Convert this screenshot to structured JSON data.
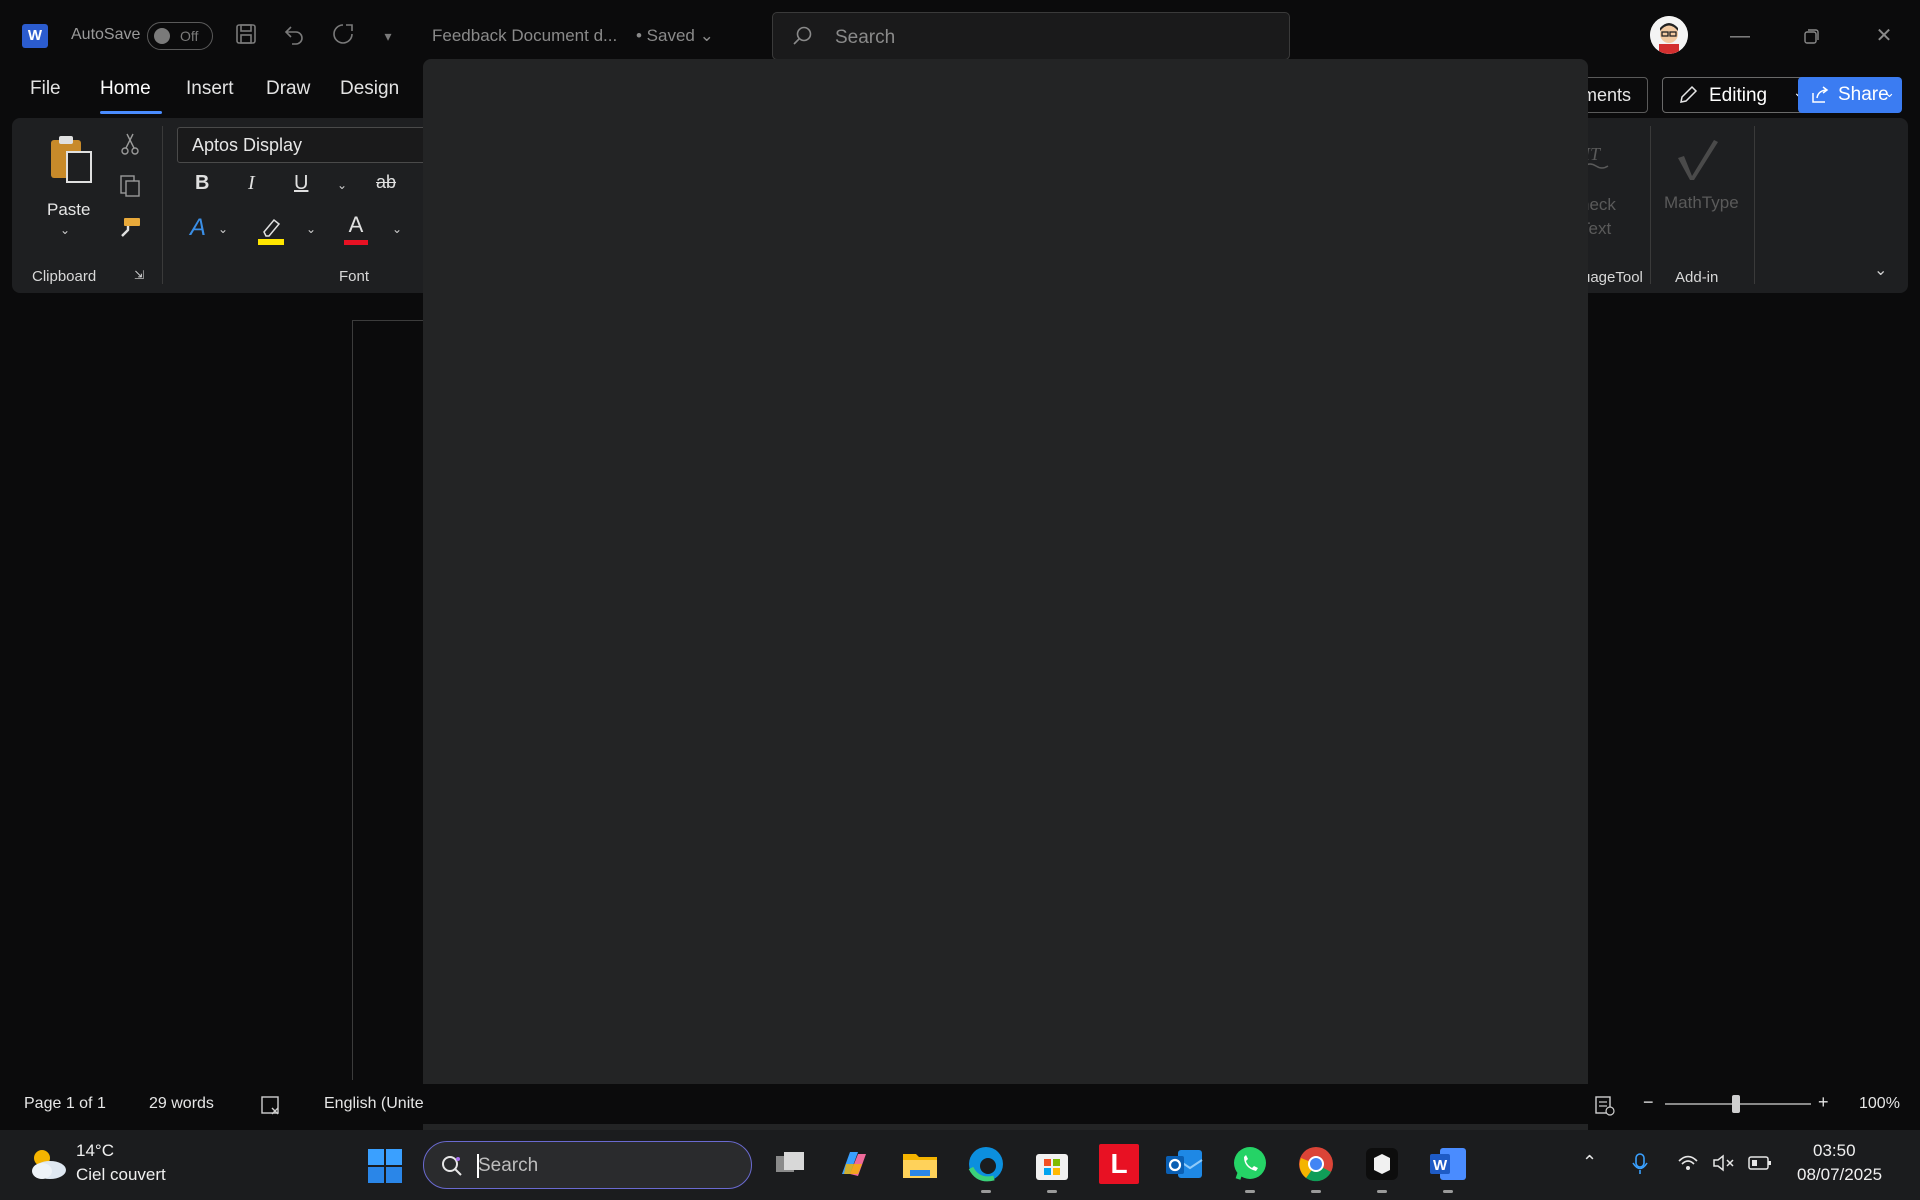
{
  "titlebar": {
    "app_logo": "W",
    "autosave_label": "AutoSave",
    "autosave_state": "Off",
    "document_title": "Feedback Document d...",
    "saved_status": "• Saved",
    "search_placeholder": "Search",
    "icons": [
      "word-logo-icon",
      "save-icon",
      "undo-icon",
      "redo-icon",
      "customize-qat-icon",
      "search-icon",
      "minimize-icon",
      "restore-icon",
      "close-icon"
    ]
  },
  "tabs": [
    "File",
    "Home",
    "Insert",
    "Draw",
    "Design"
  ],
  "active_tab": "Home",
  "right_buttons": {
    "comments": "ments",
    "editing": "Editing",
    "share": "Share"
  },
  "ribbon": {
    "paste_label": "Paste",
    "clipboard_label": "Clipboard",
    "font_name": "Aptos Display",
    "font_label": "Font",
    "bold": "B",
    "italic": "I",
    "underline": "U",
    "strikethrough": "ab",
    "text_effects": "A",
    "font_color": "A",
    "check_text_line1": "heck",
    "check_text_line2": "Text",
    "languagetool_label": "uageTool",
    "mathtype_label": "MathType",
    "addin_label": "Add-in",
    "colors": {
      "highlight": "#ffe600",
      "font_color": "#e81123",
      "text_effects": "#3a8ee6"
    }
  },
  "statusbar": {
    "page": "Page 1 of 1",
    "words": "29 words",
    "language": "English (United",
    "zoom": "100%",
    "zoom_minus": "−",
    "zoom_plus": "+"
  },
  "taskbar": {
    "weather_temp": "14°C",
    "weather_desc": "Ciel couvert",
    "search_placeholder": "Search",
    "apps": [
      "task-view",
      "copilot",
      "file-explorer",
      "edge",
      "microsoft-store",
      "l-app",
      "outlook",
      "whatsapp",
      "chrome",
      "app-box",
      "word"
    ],
    "l_app_letter": "L",
    "time": "03:50",
    "date": "08/07/2025"
  }
}
